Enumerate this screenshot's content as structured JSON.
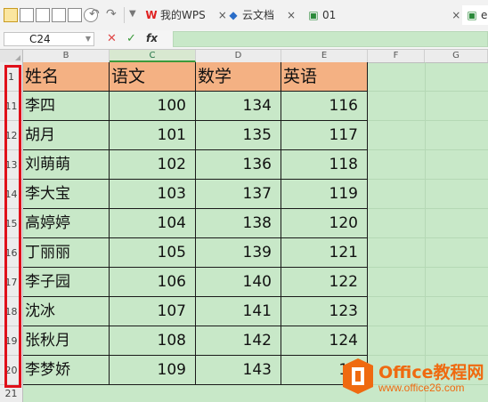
{
  "toolbar": {
    "tabs": [
      {
        "label": "我的WPS",
        "icon": "wps-logo-icon"
      },
      {
        "label": "云文档",
        "icon": "cloud-doc-icon"
      },
      {
        "label": "01",
        "icon": "spreadsheet-file-icon"
      },
      {
        "label": "e",
        "icon": "spreadsheet-file-icon"
      }
    ]
  },
  "formula_bar": {
    "name_box": "C24",
    "cancel_icon": "close-icon",
    "confirm_icon": "check-icon",
    "fx_label": "fx",
    "value": ""
  },
  "columns": [
    "B",
    "C",
    "D",
    "E",
    "F",
    "G"
  ],
  "active_column": "C",
  "header_row": {
    "row": "1",
    "cells": [
      "姓名",
      "语文",
      "数学",
      "英语"
    ]
  },
  "rows": [
    {
      "row": "11",
      "name": "李四",
      "chinese": "100",
      "math": "134",
      "english": "116"
    },
    {
      "row": "12",
      "name": "胡月",
      "chinese": "101",
      "math": "135",
      "english": "117"
    },
    {
      "row": "13",
      "name": "刘萌萌",
      "chinese": "102",
      "math": "136",
      "english": "118"
    },
    {
      "row": "14",
      "name": "李大宝",
      "chinese": "103",
      "math": "137",
      "english": "119"
    },
    {
      "row": "15",
      "name": "高婷婷",
      "chinese": "104",
      "math": "138",
      "english": "120"
    },
    {
      "row": "16",
      "name": "丁丽丽",
      "chinese": "105",
      "math": "139",
      "english": "121"
    },
    {
      "row": "17",
      "name": "李子园",
      "chinese": "106",
      "math": "140",
      "english": "122"
    },
    {
      "row": "18",
      "name": "沈冰",
      "chinese": "107",
      "math": "141",
      "english": "123"
    },
    {
      "row": "19",
      "name": "张秋月",
      "chinese": "108",
      "math": "142",
      "english": "124"
    },
    {
      "row": "20",
      "name": "李梦娇",
      "chinese": "109",
      "math": "143",
      "english": "12"
    }
  ],
  "extra_row": "21",
  "watermark": {
    "brand": "Office教程网",
    "url": "www.office26.com"
  },
  "colors": {
    "sheet_bg": "#c8e8c8",
    "header_fill": "#f4b183",
    "highlight": "#e0101a",
    "brand": "#ef6a10"
  }
}
